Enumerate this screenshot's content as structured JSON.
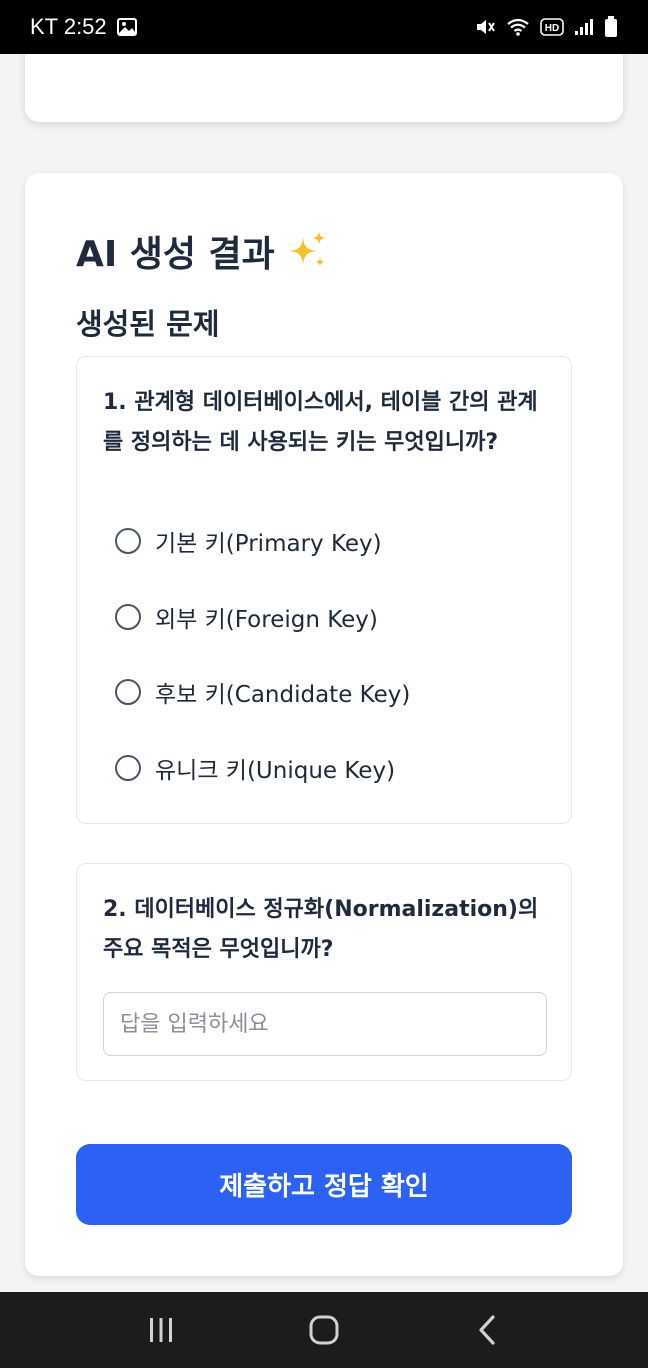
{
  "status_bar": {
    "carrier_time": "KT 2:52",
    "icons": [
      "gallery-icon",
      "mute-icon",
      "wifi-icon",
      "hd-icon",
      "signal-icon",
      "battery-icon"
    ],
    "hd_label": "HD"
  },
  "result": {
    "title": "AI 생성 결과",
    "title_emoji": "sparkles-icon",
    "section_title": "생성된 문제"
  },
  "questions": [
    {
      "text": "1. 관계형 데이터베이스에서, 테이블 간의 관계를 정의하는 데 사용되는 키는 무엇입니까?",
      "options": [
        "기본 키(Primary Key)",
        "외부 키(Foreign Key)",
        "후보 키(Candidate Key)",
        "유니크 키(Unique Key)"
      ]
    },
    {
      "text": "2. 데이터베이스 정규화(Normalization)의 주요 목적은 무엇입니까?",
      "answer_value": "",
      "answer_placeholder": "답을 입력하세요"
    }
  ],
  "submit_label": "제출하고 정답 확인",
  "colors": {
    "accent_blue": "#2b62f4",
    "accent_green": "#4caa4f",
    "background": "#f3f4f6"
  },
  "nav": {
    "icons": [
      "recent-apps-icon",
      "home-icon",
      "back-icon"
    ]
  }
}
